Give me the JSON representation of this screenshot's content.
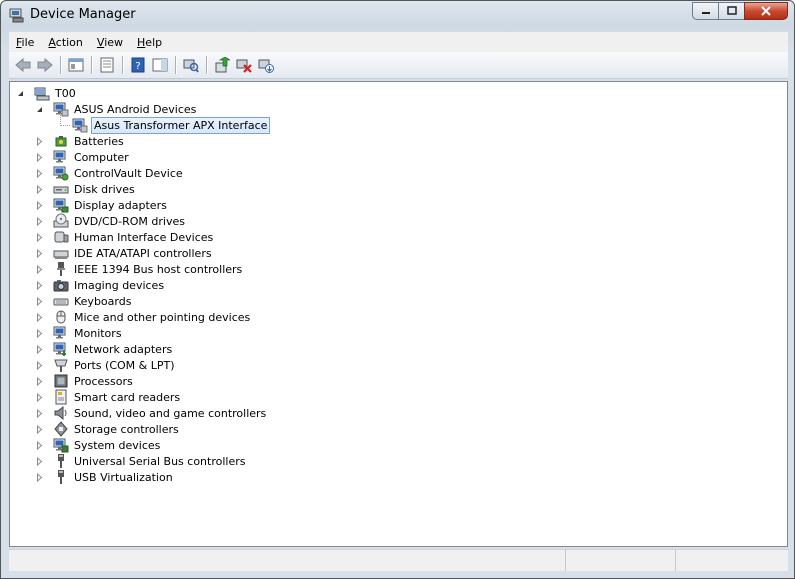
{
  "window": {
    "title": "Device Manager",
    "buttons": {
      "minimize": "minimize",
      "maximize": "maximize",
      "close": "close"
    }
  },
  "menu": [
    {
      "label": "File",
      "hotkey": "F",
      "rest": "ile"
    },
    {
      "label": "Action",
      "hotkey": "A",
      "rest": "ction"
    },
    {
      "label": "View",
      "hotkey": "V",
      "rest": "iew"
    },
    {
      "label": "Help",
      "hotkey": "H",
      "rest": "elp"
    }
  ],
  "toolbar": {
    "icons": [
      "back-icon",
      "forward-icon",
      "show-hide-console-tree-icon",
      "properties-icon",
      "help-icon",
      "action-pane-icon",
      "scan-hardware-icon",
      "update-driver-icon",
      "uninstall-icon",
      "disable-device-icon"
    ]
  },
  "tree": {
    "root": "T00",
    "expanded": {
      "label": "ASUS Android Devices",
      "child": "Asus Transformer APX Interface"
    },
    "categories": [
      "Batteries",
      "Computer",
      "ControlVault Device",
      "Disk drives",
      "Display adapters",
      "DVD/CD-ROM drives",
      "Human Interface Devices",
      "IDE ATA/ATAPI controllers",
      "IEEE 1394 Bus host controllers",
      "Imaging devices",
      "Keyboards",
      "Mice and other pointing devices",
      "Monitors",
      "Network adapters",
      "Ports (COM & LPT)",
      "Processors",
      "Smart card readers",
      "Sound, video and game controllers",
      "Storage controllers",
      "System devices",
      "Universal Serial Bus controllers",
      "USB Virtualization"
    ],
    "category_icons": [
      "battery-icon",
      "computer-icon",
      "controlvault-icon",
      "disk-drive-icon",
      "display-adapter-icon",
      "dvd-drive-icon",
      "hid-icon",
      "ide-controller-icon",
      "ieee1394-icon",
      "imaging-device-icon",
      "keyboard-icon",
      "mouse-icon",
      "monitor-icon",
      "network-adapter-icon",
      "port-icon",
      "processor-icon",
      "smart-card-reader-icon",
      "sound-icon",
      "storage-controller-icon",
      "system-device-icon",
      "usb-controller-icon",
      "usb-virtualization-icon"
    ]
  }
}
